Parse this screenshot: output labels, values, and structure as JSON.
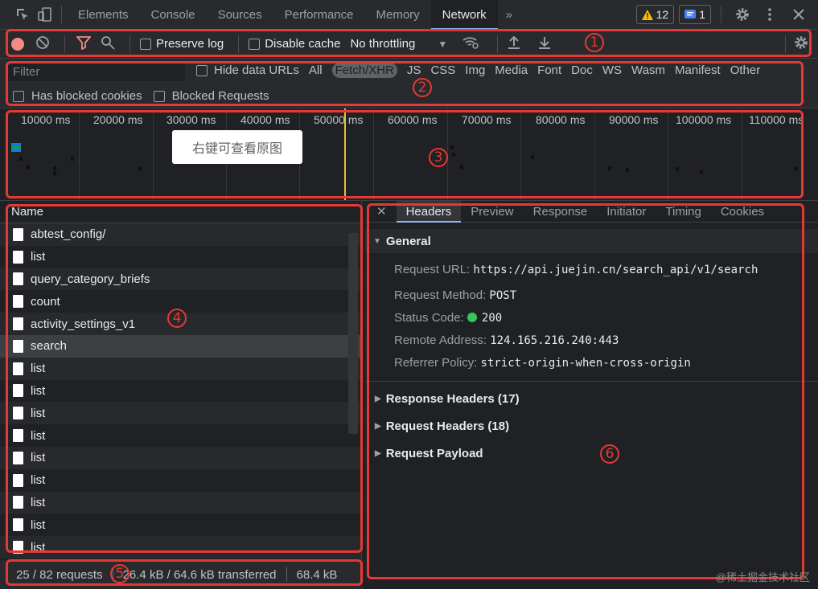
{
  "main_tabs": {
    "items": [
      "Elements",
      "Console",
      "Sources",
      "Performance",
      "Memory",
      "Network"
    ],
    "active": "Network",
    "overflow": "»",
    "warnings": "12",
    "messages": "1"
  },
  "toolbar": {
    "preserve_log": "Preserve log",
    "disable_cache": "Disable cache",
    "throttling": "No throttling"
  },
  "filter": {
    "placeholder": "Filter",
    "hide_data_urls": "Hide data URLs",
    "types": [
      "All",
      "Fetch/XHR",
      "JS",
      "CSS",
      "Img",
      "Media",
      "Font",
      "Doc",
      "WS",
      "Wasm",
      "Manifest",
      "Other"
    ],
    "active_type": "Fetch/XHR",
    "has_blocked_cookies": "Has blocked cookies",
    "blocked_requests": "Blocked Requests"
  },
  "overview": {
    "ticks": [
      "10000 ms",
      "20000 ms",
      "30000 ms",
      "40000 ms",
      "50000 ms",
      "60000 ms",
      "70000 ms",
      "80000 ms",
      "90000 ms",
      "100000 ms",
      "110000 ms"
    ],
    "tooltip": "右键可查看原图"
  },
  "request_list": {
    "header": "Name",
    "rows": [
      "abtest_config/",
      "list",
      "query_category_briefs",
      "count",
      "activity_settings_v1",
      "search",
      "list",
      "list",
      "list",
      "list",
      "list",
      "list",
      "list",
      "list",
      "list"
    ],
    "selected_index": 5
  },
  "status_bar": {
    "requests": "25 / 82 requests",
    "transferred": "26.4 kB / 64.6 kB transferred",
    "resources": "68.4 kB"
  },
  "details": {
    "tabs": [
      "Headers",
      "Preview",
      "Response",
      "Initiator",
      "Timing",
      "Cookies"
    ],
    "active_tab": "Headers",
    "general_title": "General",
    "request_url_label": "Request URL:",
    "request_url": "https://api.juejin.cn/search_api/v1/search",
    "request_method_label": "Request Method:",
    "request_method": "POST",
    "status_code_label": "Status Code:",
    "status_code": "200",
    "remote_address_label": "Remote Address:",
    "remote_address": "124.165.216.240:443",
    "referrer_policy_label": "Referrer Policy:",
    "referrer_policy": "strict-origin-when-cross-origin",
    "response_headers": "Response Headers (17)",
    "request_headers": "Request Headers (18)",
    "request_payload": "Request Payload"
  },
  "annotations": [
    "1",
    "2",
    "3",
    "4",
    "5",
    "6"
  ],
  "watermark": "@稀土掘金技术社区",
  "colors": {
    "annotation": "#e53935",
    "accent": "#8ab4f8",
    "record": "#f28b82",
    "status_ok": "#34c759",
    "marker": "#e6c229"
  }
}
